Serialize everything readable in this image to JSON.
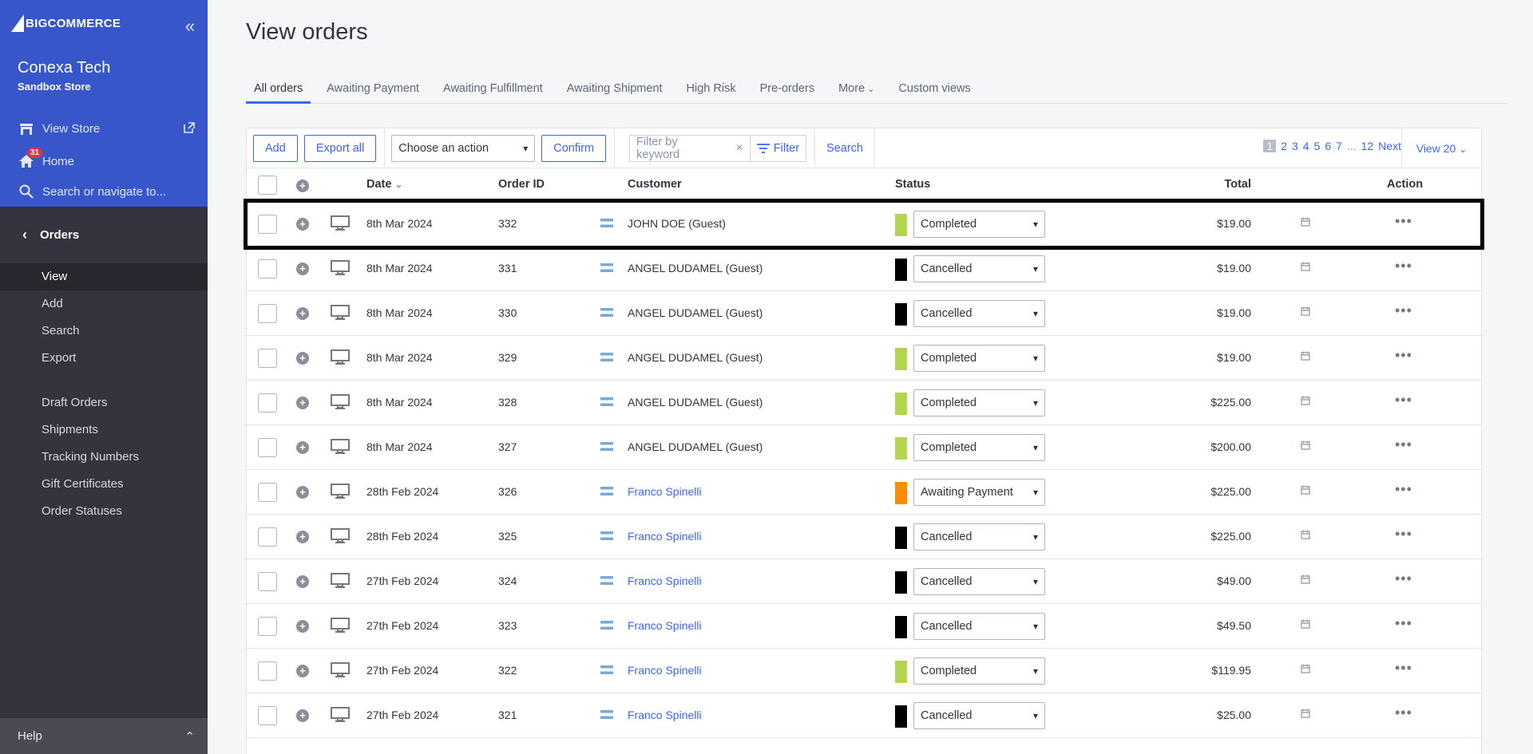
{
  "brand": {
    "logo_text": "BIGCOMMERCE"
  },
  "store": {
    "name": "Conexa Tech",
    "subtitle": "Sandbox Store"
  },
  "nav": {
    "view_store": "View Store",
    "home": "Home",
    "home_badge": "31",
    "search": "Search or navigate to...",
    "section": "Orders",
    "sub_items": [
      "View",
      "Add",
      "Search",
      "Export"
    ],
    "extra_items": [
      "Draft Orders",
      "Shipments",
      "Tracking Numbers",
      "Gift Certificates",
      "Order Statuses"
    ],
    "help": "Help"
  },
  "page": {
    "title": "View orders"
  },
  "tabs": [
    "All orders",
    "Awaiting Payment",
    "Awaiting Fulfillment",
    "Awaiting Shipment",
    "High Risk",
    "Pre-orders",
    "More",
    "Custom views"
  ],
  "toolbar": {
    "add": "Add",
    "export_all": "Export all",
    "action_select": "Choose an action",
    "confirm": "Confirm",
    "filter_placeholder": "Filter by keyword",
    "filter": "Filter",
    "search": "Search",
    "pages": [
      "1",
      "2",
      "3",
      "4",
      "5",
      "6",
      "7",
      "...",
      "12"
    ],
    "next": "Next",
    "view": "View 20"
  },
  "columns": {
    "date": "Date",
    "order_id": "Order ID",
    "customer": "Customer",
    "status": "Status",
    "total": "Total",
    "action": "Action"
  },
  "colors": {
    "Completed": "#b3d44e",
    "Cancelled": "#000000",
    "Awaiting Payment": "#ff8c00",
    "accent": "#3c64f4"
  },
  "orders": [
    {
      "date": "8th Mar 2024",
      "id": "332",
      "customer": "JOHN DOE (Guest)",
      "link": false,
      "status": "Completed",
      "total": "$19.00"
    },
    {
      "date": "8th Mar 2024",
      "id": "331",
      "customer": "ANGEL DUDAMEL (Guest)",
      "link": false,
      "status": "Cancelled",
      "total": "$19.00"
    },
    {
      "date": "8th Mar 2024",
      "id": "330",
      "customer": "ANGEL DUDAMEL (Guest)",
      "link": false,
      "status": "Cancelled",
      "total": "$19.00"
    },
    {
      "date": "8th Mar 2024",
      "id": "329",
      "customer": "ANGEL DUDAMEL (Guest)",
      "link": false,
      "status": "Completed",
      "total": "$19.00"
    },
    {
      "date": "8th Mar 2024",
      "id": "328",
      "customer": "ANGEL DUDAMEL (Guest)",
      "link": false,
      "status": "Completed",
      "total": "$225.00"
    },
    {
      "date": "8th Mar 2024",
      "id": "327",
      "customer": "ANGEL DUDAMEL (Guest)",
      "link": false,
      "status": "Completed",
      "total": "$200.00"
    },
    {
      "date": "28th Feb 2024",
      "id": "326",
      "customer": "Franco Spinelli",
      "link": true,
      "status": "Awaiting Payment",
      "total": "$225.00"
    },
    {
      "date": "28th Feb 2024",
      "id": "325",
      "customer": "Franco Spinelli",
      "link": true,
      "status": "Cancelled",
      "total": "$225.00"
    },
    {
      "date": "27th Feb 2024",
      "id": "324",
      "customer": "Franco Spinelli",
      "link": true,
      "status": "Cancelled",
      "total": "$49.00"
    },
    {
      "date": "27th Feb 2024",
      "id": "323",
      "customer": "Franco Spinelli",
      "link": true,
      "status": "Cancelled",
      "total": "$49.50"
    },
    {
      "date": "27th Feb 2024",
      "id": "322",
      "customer": "Franco Spinelli",
      "link": true,
      "status": "Completed",
      "total": "$119.95"
    },
    {
      "date": "27th Feb 2024",
      "id": "321",
      "customer": "Franco Spinelli",
      "link": true,
      "status": "Cancelled",
      "total": "$25.00"
    }
  ]
}
